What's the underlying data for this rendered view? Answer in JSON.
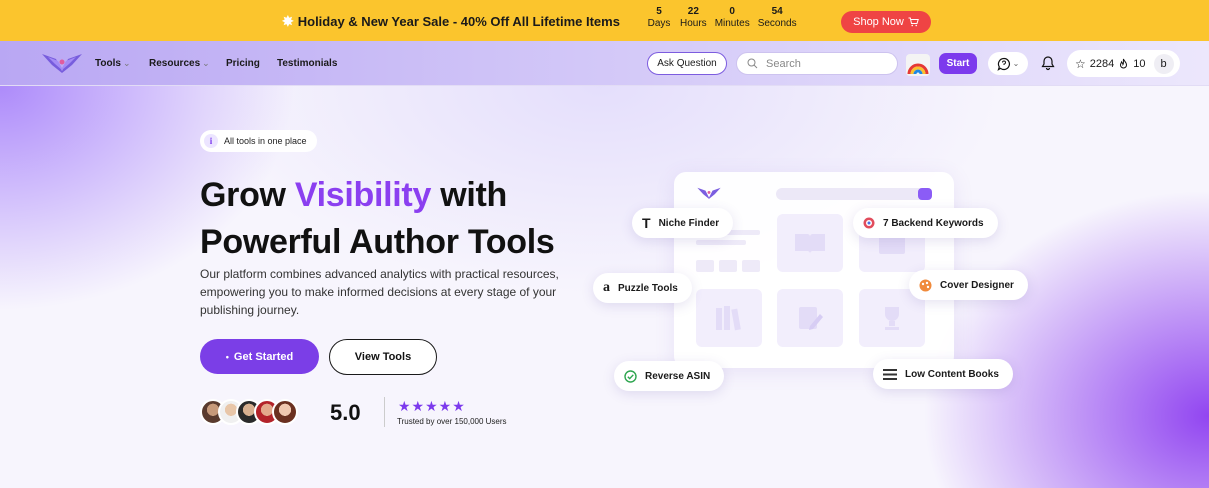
{
  "promo": {
    "title": "Holiday & New Year Sale - 40% Off All Lifetime Items",
    "countdown": [
      {
        "value": "5",
        "label": "Days"
      },
      {
        "value": "22",
        "label": "Hours"
      },
      {
        "value": "0",
        "label": "Minutes"
      },
      {
        "value": "54",
        "label": "Seconds"
      }
    ],
    "shop_button": "Shop Now",
    "shop_icon": "cart-icon"
  },
  "nav": {
    "links": [
      {
        "label": "Tools",
        "has_dropdown": true
      },
      {
        "label": "Resources",
        "has_dropdown": true
      },
      {
        "label": "Pricing",
        "has_dropdown": false
      },
      {
        "label": "Testimonials",
        "has_dropdown": false
      }
    ],
    "ask_button": "Ask Question",
    "search_placeholder": "Search",
    "start_button": "Start",
    "stars_count": "2284",
    "likes_count": "10",
    "user_initial": "b"
  },
  "hero": {
    "badge": "All tools in one place",
    "badge_icon": "i",
    "headline_line1_prefix": "Grow ",
    "headline_line1_accent": "Visibility",
    "headline_line1_suffix": " with",
    "headline_line2": "Powerful Author Tools",
    "description": "Our platform combines advanced analytics with practical resources, empowering you to make informed decisions at every stage of your publishing journey.",
    "primary_cta": "Get Started",
    "secondary_cta": "View Tools",
    "rating": "5.0",
    "stars": "★★★★★",
    "trusted_text": "Trusted by over 150,000 Users"
  },
  "features": {
    "niche_finder": "Niche Finder",
    "backend_keywords": "7 Backend Keywords",
    "puzzle_tools": "Puzzle Tools",
    "cover_designer": "Cover Designer",
    "reverse_asin": "Reverse ASIN",
    "low_content_books": "Low Content Books"
  },
  "colors": {
    "banner": "#fbc52d",
    "accent": "#7c3aed",
    "shop_button": "#ef4444"
  }
}
